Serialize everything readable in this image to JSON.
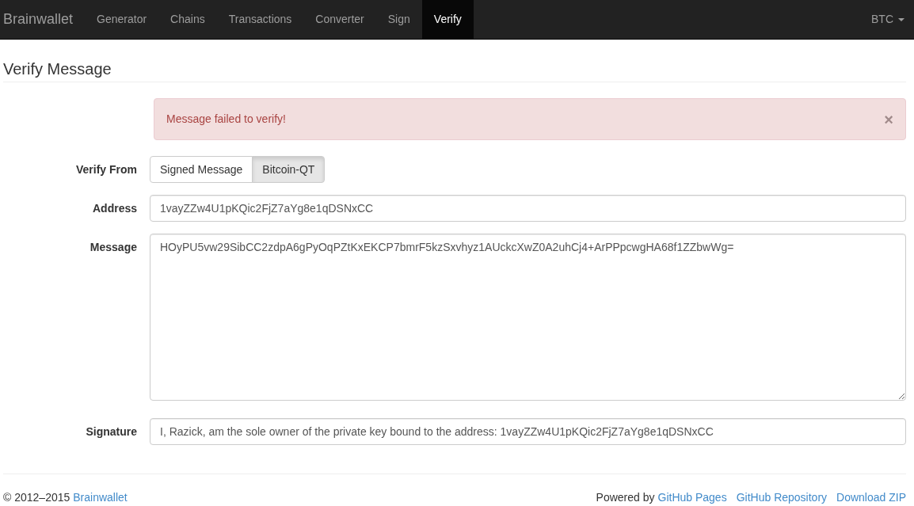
{
  "navbar": {
    "brand": "Brainwallet",
    "items": [
      {
        "label": "Generator",
        "selected": false
      },
      {
        "label": "Chains",
        "selected": false
      },
      {
        "label": "Transactions",
        "selected": false
      },
      {
        "label": "Converter",
        "selected": false
      },
      {
        "label": "Sign",
        "selected": false
      },
      {
        "label": "Verify",
        "selected": true
      }
    ],
    "currency": "BTC"
  },
  "page_title": "Verify Message",
  "alert": {
    "message": "Message failed to verify!",
    "close": "×"
  },
  "form": [
    {
      "kind": "toggle",
      "label": "Verify From",
      "options": [
        {
          "label": "Signed Message",
          "selected": false
        },
        {
          "label": "Bitcoin-QT",
          "selected": true
        }
      ]
    },
    {
      "kind": "input",
      "label": "Address",
      "value": "1vayZZw4U1pKQic2FjZ7aYg8e1qDSNxCC"
    },
    {
      "kind": "textarea",
      "label": "Message",
      "value": "HOyPU5vw29SibCC2zdpA6gPyOqPZtKxEKCP7bmrF5kzSxvhyz1AUckcXwZ0A2uhCj4+ArPPpcwgHA68f1ZZbwWg="
    },
    {
      "kind": "input",
      "label": "Signature",
      "value": "I, Razick, am the sole owner of the private key bound to the address: 1vayZZw4U1pKQic2FjZ7aYg8e1qDSNxCC"
    }
  ],
  "footer": {
    "copyright": "© 2012–2015",
    "copyright_link": "Brainwallet",
    "powered_by": "Powered by",
    "links": [
      "GitHub Pages",
      "GitHub Repository",
      "Download ZIP"
    ]
  }
}
